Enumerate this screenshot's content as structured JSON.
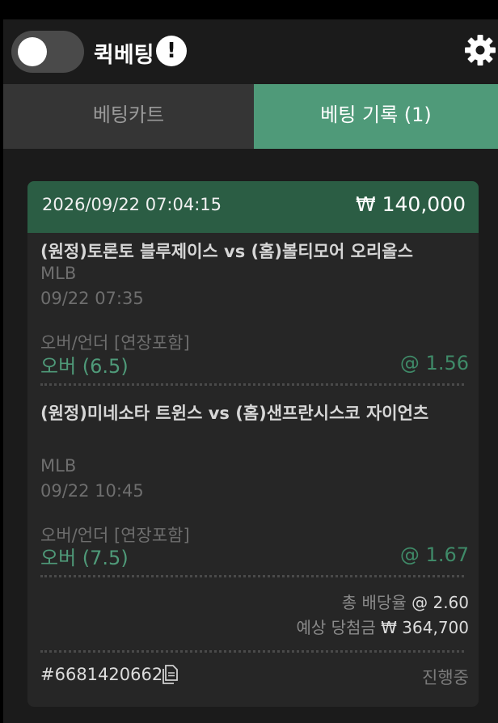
{
  "header": {
    "quick_bet_label": "퀵베팅",
    "info_icon_glyph": "!",
    "toggle_state": "off",
    "icons": [
      "toggle",
      "info-icon",
      "gear-icon"
    ]
  },
  "tabs": [
    {
      "label": "베팅카트",
      "active": false
    },
    {
      "label": "베팅 기록 (1)",
      "active": true
    }
  ],
  "colors": {
    "accent": "#4f9a79",
    "card_header": "#2b5d44"
  },
  "bet": {
    "datetime": "2026/09/22 07:04:15",
    "amount": "₩ 140,000",
    "selections": [
      {
        "match": "(원정)토론토 블루제이스 vs (홈)볼티모어 오리올스",
        "league": "MLB",
        "time": "09/22 07:35",
        "market": "오버/언더 [연장포함]",
        "pick": "오버 (6.5)",
        "odds": "@ 1.56"
      },
      {
        "match": "(원정)미네소타 트윈스 vs (홈)샌프란시스코 자이언츠",
        "league": "MLB",
        "time": "09/22 10:45",
        "market": "오버/언더 [연장포함]",
        "pick": "오버 (7.5)",
        "odds": "@ 1.67"
      }
    ],
    "total_odds_label": "총 배당율",
    "total_odds": "@ 2.60",
    "expected_win_label": "예상 당첨금",
    "expected_win": "₩ 364,700",
    "ticket_id": "#6681420662",
    "status": "진행중"
  }
}
